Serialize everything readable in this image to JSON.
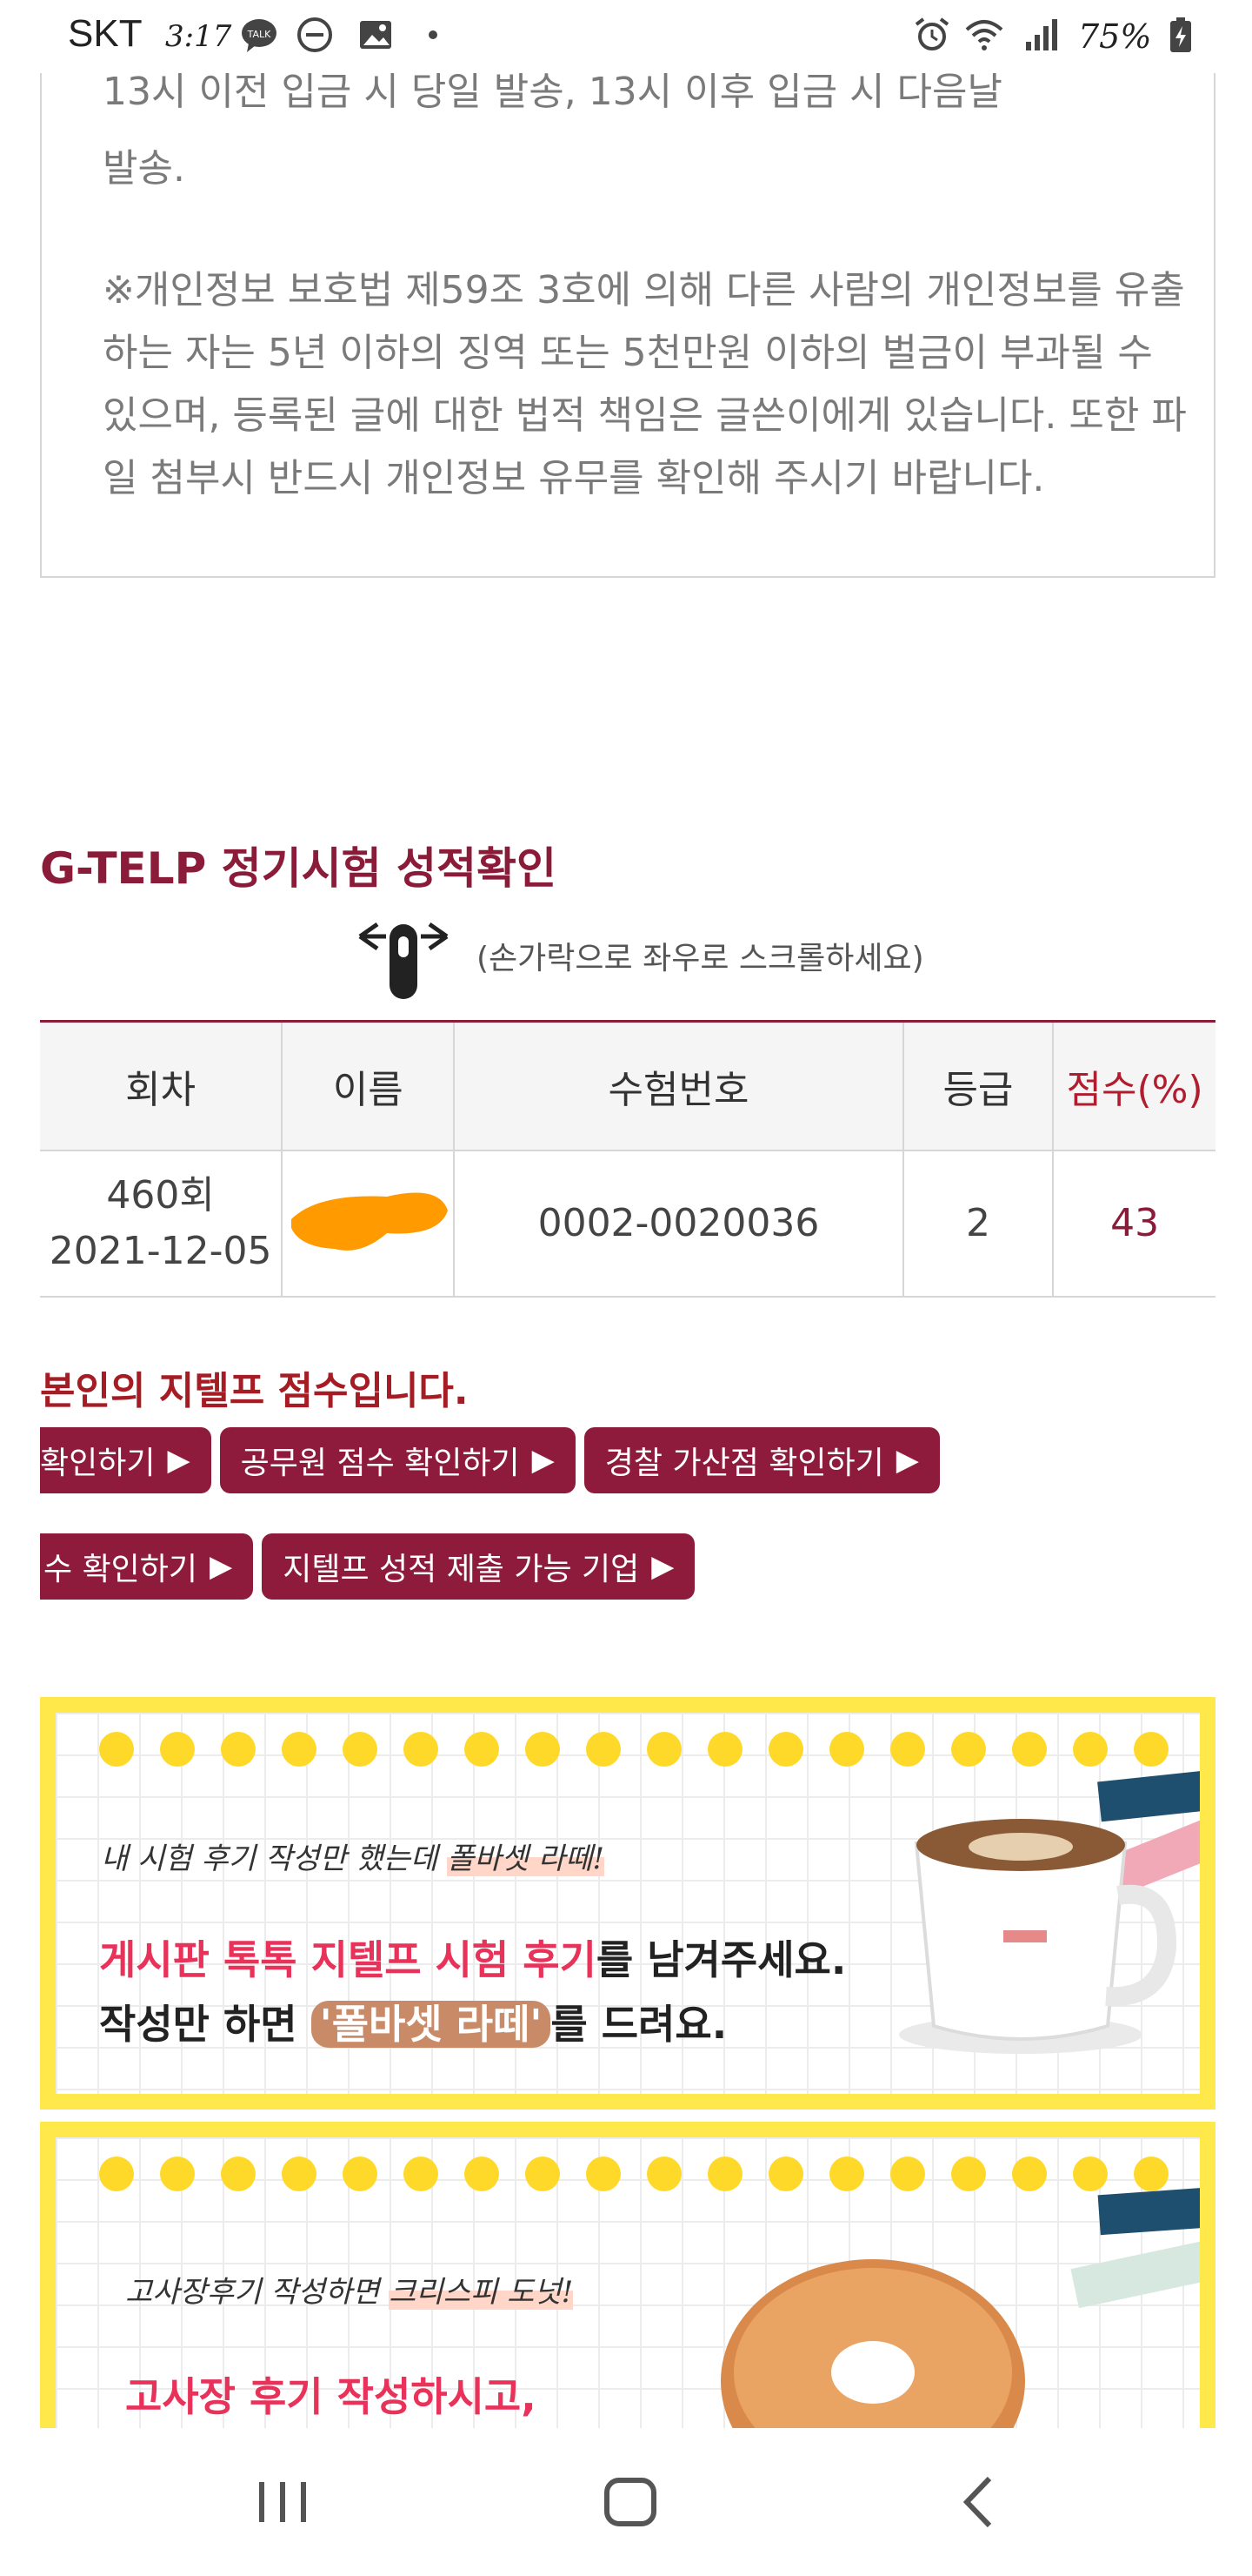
{
  "status_bar": {
    "carrier": "SKT",
    "time": "3:17",
    "battery": "75%"
  },
  "notice": {
    "cut_line": "13시 이전 입금 시 당일 발송, 13시 이후 입금 시 다음날",
    "cut_end": "발송.",
    "privacy": "※개인정보 보호법 제59조 3호에 의해 다른 사람의 개인정보를 유출하는 자는 5년 이하의 징역 또는 5천만원 이하의 벌금이 부과될 수 있으며, 등록된 글에 대한 법적 책임은 글쓴이에게 있습니다. 또한 파일 첨부시 반드시 개인정보 유무를 확인해 주시기 바랍니다."
  },
  "score_section": {
    "title": "G-TELP 정기시험 성적확인",
    "scroll_hint": "(손가락으로 좌우로 스크롤하세요)",
    "headers": [
      "회차",
      "이름",
      "수험번호",
      "등급",
      "점수(%)"
    ],
    "row": {
      "session": "460회",
      "date": "2021-12-05",
      "exam_number": "0002-0020036",
      "grade": "2",
      "score": "43"
    },
    "own_score_text": "본인의 지텔프 점수입니다."
  },
  "buttons": {
    "row1": [
      "확인하기",
      "공무원 점수 확인하기",
      "경찰 가산점 확인하기"
    ],
    "row2": [
      "수 확인하기",
      "지텔프 성적 제출 가능 기업"
    ],
    "arrow": "▶"
  },
  "banner1": {
    "small": "내 시험 후기 작성만 했는데 ",
    "small_highlight": "폴바셋 라떼!",
    "line1_pink": "게시판 톡톡 지텔프 시험 후기",
    "line1_rest": "를 남겨주세요.",
    "line2_start": "작성만 하면 ",
    "line2_tag": "'폴바셋 라떼'",
    "line2_end": "를 드려요."
  },
  "banner2": {
    "small": "고사장후기 작성하면 ",
    "small_highlight": "크리스피 도넛!",
    "line1_pink": "고사장 후기 작성하시고,"
  },
  "colors": {
    "brand": "#8e1b3c",
    "title": "#8a1c3a",
    "banner_yellow": "#ffe94a",
    "pink": "#e8325a"
  }
}
